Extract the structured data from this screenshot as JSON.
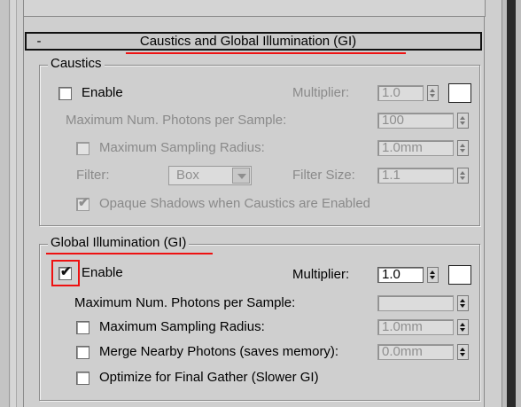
{
  "rollout": {
    "collapse_symbol": "-",
    "title": "Caustics and Global Illumination (GI)"
  },
  "caustics": {
    "legend": "Caustics",
    "enable_label": "Enable",
    "enable_checked": false,
    "multiplier_label": "Multiplier:",
    "multiplier_value": "1.0",
    "max_photons_label": "Maximum Num. Photons per Sample:",
    "max_photons_value": "100",
    "max_radius_label": "Maximum Sampling Radius:",
    "max_radius_checked": false,
    "max_radius_value": "1.0mm",
    "filter_label": "Filter:",
    "filter_value": "Box",
    "filter_size_label": "Filter Size:",
    "filter_size_value": "1.1",
    "opaque_shadows_label": "Opaque Shadows when Caustics are Enabled",
    "opaque_shadows_checked": true
  },
  "gi": {
    "legend": "Global Illumination (GI)",
    "enable_label": "Enable",
    "enable_checked": true,
    "multiplier_label": "Multiplier:",
    "multiplier_value": "1.0",
    "max_photons_label": "Maximum Num. Photons per Sample:",
    "max_photons_value": "",
    "max_radius_label": "Maximum Sampling Radius:",
    "max_radius_checked": false,
    "max_radius_value": "1.0mm",
    "merge_label": "Merge Nearby Photons (saves memory):",
    "merge_checked": false,
    "merge_value": "0.0mm",
    "optimize_label": "Optimize for Final Gather (Slower GI)",
    "optimize_checked": false
  },
  "icons": {
    "checkmark": "✔"
  },
  "colors": {
    "annotation_red": "#e11111",
    "panel_bg": "#cfcfcf"
  }
}
